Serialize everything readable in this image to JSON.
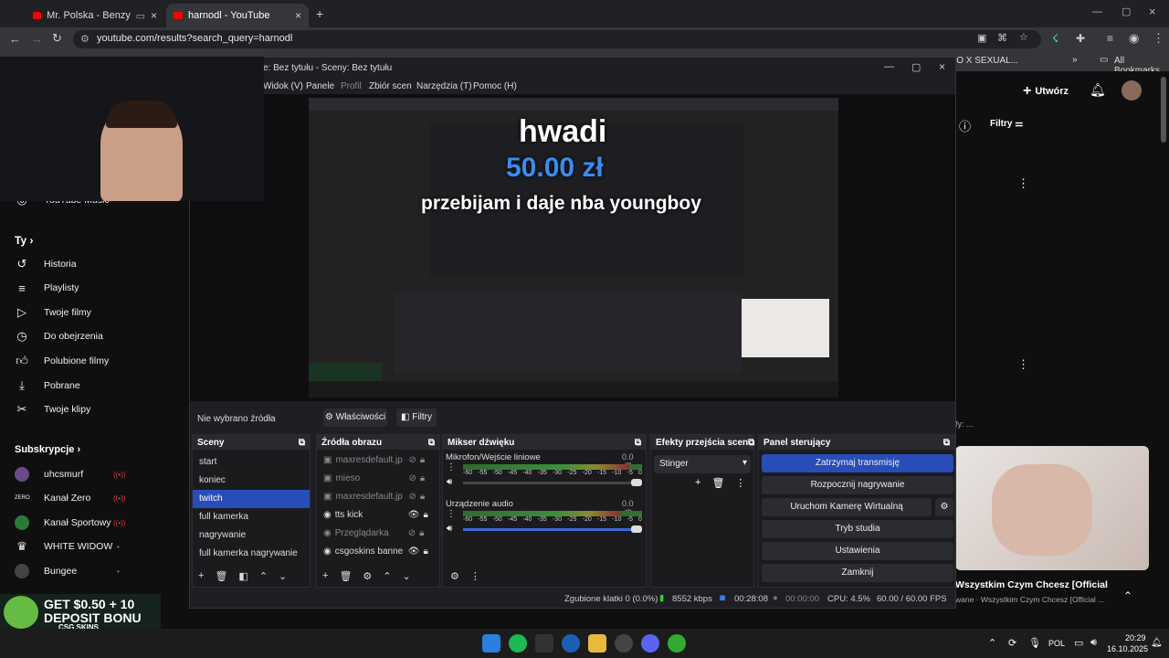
{
  "browser": {
    "tabs": [
      {
        "label": "Mr. Polska - Benzyna (Patry"
      },
      {
        "label": "harnodl - YouTube"
      }
    ],
    "url": "youtube.com/results?search_query=harnodl",
    "bookmark_folder": "NO X SEXUAL...",
    "all_bookmarks": "All Bookmarks"
  },
  "yt": {
    "create_label": "Utwórz",
    "filters_label": "Filtry",
    "you_label": "Ty",
    "yt_music": "YouTube Music",
    "nav": [
      {
        "label": "Historia",
        "icon": "history-icon"
      },
      {
        "label": "Playlisty",
        "icon": "playlist-icon"
      },
      {
        "label": "Twoje filmy",
        "icon": "video-icon"
      },
      {
        "label": "Do obejrzenia",
        "icon": "clock-icon"
      },
      {
        "label": "Polubione filmy",
        "icon": "like-icon"
      },
      {
        "label": "Pobrane",
        "icon": "download-icon"
      },
      {
        "label": "Twoje klipy",
        "icon": "scissors-icon"
      }
    ],
    "subs_title": "Subskrypcje",
    "subs": [
      {
        "label": "uhcsmurf"
      },
      {
        "label": "Kanał Zero"
      },
      {
        "label": "Kanał Sportowy"
      },
      {
        "label": "WHITE WIDOW"
      },
      {
        "label": "Bungee"
      }
    ],
    "video_title": "Wszystkim Czym Chcesz [Official Music ...",
    "video_channel": "wane · Wszystkim Czym Chcesz [Official ...",
    "partial_text": "fy: ..."
  },
  "obs": {
    "title": "e: Bez tytułu - Sceny: Bez tytułu",
    "menu": [
      "Widok (V)",
      "Panele",
      "Profil",
      "Zbiór scen",
      "Narzędzia (T)",
      "Pomoc (H)"
    ],
    "overlay": {
      "name": "hwadi",
      "amount": "50.00 zł",
      "message": "przebijam i daje nba youngboy"
    },
    "no_source": "Nie wybrano źródła",
    "properties": "Właściwości",
    "filters": "Filtry",
    "scenes_title": "Sceny",
    "scenes": [
      "start",
      "koniec",
      "twitch",
      "full kamerka",
      "nagrywanie",
      "full kamerka nagrywanie"
    ],
    "sources_title": "Źródła obrazu",
    "sources": [
      "maxresdefault.jp",
      "mieso",
      "maxresdefault.jp",
      "tts kick",
      "Przeglądarka",
      "csgoskins banne"
    ],
    "mixer_title": "Mikser dźwięku",
    "mixer": [
      {
        "name": "Mikrofon/Wejście liniowe",
        "db": "0.0 dB",
        "level": 0.93
      },
      {
        "name": "Urządzenie audio",
        "db": "0.0 dB",
        "level": 0.88
      }
    ],
    "ticks": [
      "-60",
      "-55",
      "-50",
      "-45",
      "-40",
      "-35",
      "-30",
      "-25",
      "-20",
      "-15",
      "-10",
      "-5",
      "0"
    ],
    "transitions_title": "Efekty przejścia scen",
    "transition": "Stinger",
    "controls_title": "Panel sterujący",
    "controls": [
      "Zatrzymaj transmisję",
      "Rozpocznij nagrywanie",
      "Uruchom Kamerę Wirtualną",
      "Tryb studia",
      "Ustawienia",
      "Zamknij"
    ],
    "status": {
      "dropped": "Zgubione klatki 0 (0.0%)",
      "bitrate": "8552 kbps",
      "stream_time": "00:28:08",
      "rec_time": "00:00:00",
      "cpu": "CPU: 4.5%",
      "fps": "60.00 / 60.00 FPS"
    }
  },
  "promo": {
    "line1": "GET $0.50 + 10",
    "line2": "DEPOSIT BONU",
    "brand": "CSG SKINS"
  },
  "taskbar": {
    "lang": "POL",
    "time": "20:29",
    "date": "16.10.2025"
  }
}
